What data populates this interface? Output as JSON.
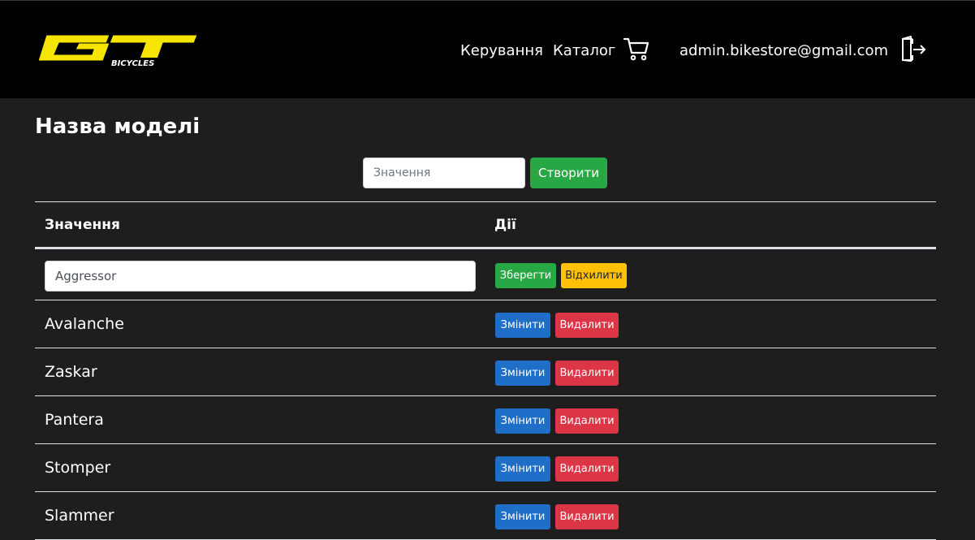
{
  "header": {
    "logo_text": "GT BICYCLES",
    "nav": {
      "manage_label": "Керування",
      "catalog_label": "Каталог"
    },
    "cart_icon": "cart-icon",
    "user_email": "admin.bikestore@gmail.com",
    "logout_icon": "logout-icon"
  },
  "page": {
    "title": "Назва моделі",
    "create_placeholder": "Значення",
    "create_button": "Створити"
  },
  "table": {
    "columns": [
      "Значення",
      "Дії"
    ],
    "editing_row": {
      "value": "Aggressor",
      "save_label": "Зберегти",
      "reject_label": "Відхилити"
    },
    "rows": [
      {
        "value": "Avalanche"
      },
      {
        "value": "Zaskar"
      },
      {
        "value": "Pantera"
      },
      {
        "value": "Stomper"
      },
      {
        "value": "Slammer"
      }
    ],
    "edit_label": "Змінити",
    "delete_label": "Видалити"
  },
  "colors": {
    "header_bg": "#000000",
    "page_bg": "#1e1e1e",
    "success": "#28a745",
    "warning": "#ffc107",
    "primary": "#1f6fc9",
    "danger": "#dc3545",
    "logo_yellow": "#f5e500"
  }
}
